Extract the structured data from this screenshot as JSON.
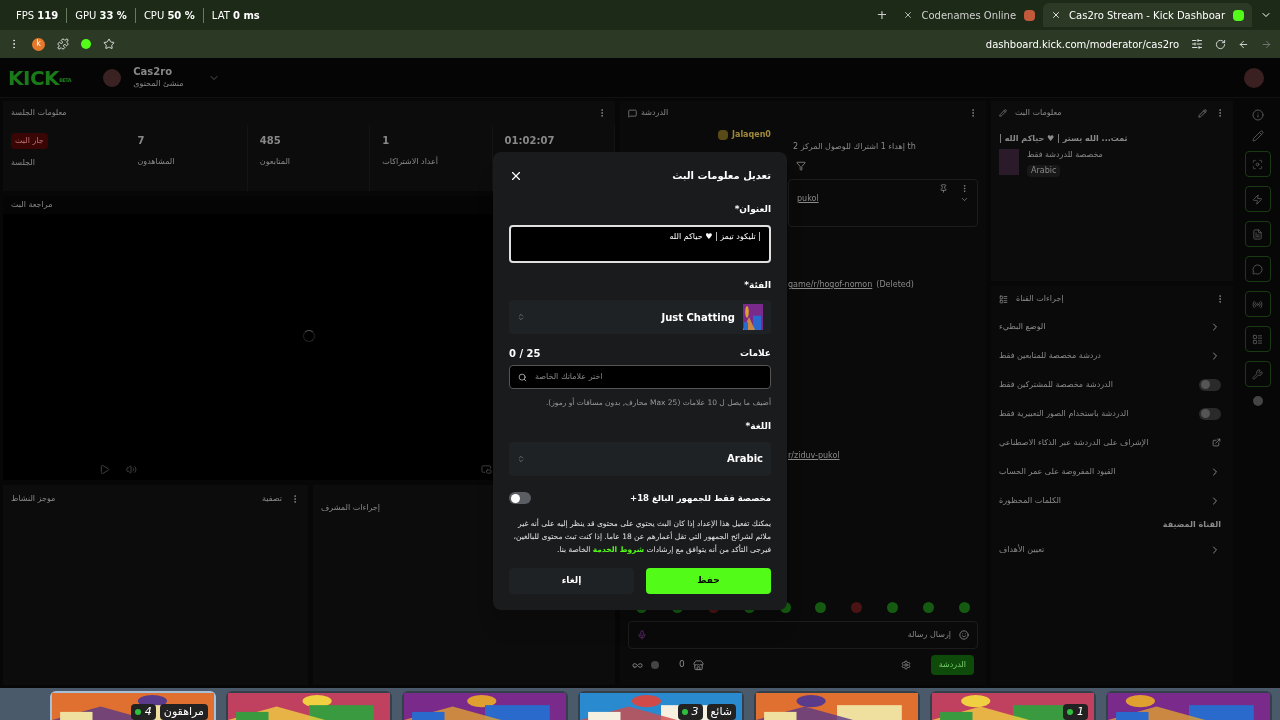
{
  "perf": [
    "LAT **0 ms**",
    "CPU **50 %**",
    "GPU **33 %**",
    "FPS **119**"
  ],
  "browser": {
    "tabs": [
      {
        "title": "Cas2ro Stream - Kick Dashboar",
        "selected": true
      },
      {
        "title": "Codenames Online",
        "selected": false
      }
    ],
    "new_tab": "+",
    "url": "dashboard.kick.com/moderator/cas2ro",
    "profile_initial": "k"
  },
  "header": {
    "logo": "KICK",
    "logo_tag": "BETA",
    "channel": "Cas2ro",
    "role": "منشئ المحتوى"
  },
  "session": {
    "title": "معلومات الجلسة",
    "stats": [
      {
        "value": "01:02:07"
      },
      {
        "value": "1",
        "label": "أعداد الاشتراكات"
      },
      {
        "value": "485",
        "label": "المتابعون"
      },
      {
        "value": "7",
        "label": "المشاهدون"
      }
    ],
    "live_badge": "جار البث",
    "live_label": "الجلسة"
  },
  "preview": {
    "title": "مراجعة البث"
  },
  "activity": {
    "title": "موجز النشاط",
    "filter": "تصفية"
  },
  "mod_actions": {
    "title": "إجراءات المشرف"
  },
  "chat": {
    "title": "الدردشة",
    "gift_user": "Jalaqen0",
    "gift_text": "إهداء 1 اشتراك للوصول المركز 2",
    "gift_suffix": "th",
    "pinned_link": "pukol",
    "messages": [
      {
        "link": "game/r/hogof-nomon",
        "note": "(Deleted)"
      },
      {
        "link": "r/ziduv-pukol"
      }
    ],
    "input_placeholder": "إرسال رسالة",
    "send": "الدردشة",
    "count": "0"
  },
  "stream_info": {
    "title": "معلومات البث",
    "stream_title": "| ثمت... الله يستر | ♥ حياكم الله",
    "category": "مخصصة للدردشة فقط",
    "language": "Arabic"
  },
  "channel_actions": {
    "title": "إجراءات القناة",
    "items": [
      {
        "kind": "chevron",
        "label": "الوضع البطيء"
      },
      {
        "kind": "chevron",
        "label": "دردشة مخصصة للمتابعين فقط"
      },
      {
        "kind": "toggle",
        "label": "الدردشة مخصصة للمشتركين فقط",
        "on": false
      },
      {
        "kind": "toggle",
        "label": "الدردشة باستخدام الصور التعبيرية فقط",
        "on": false
      },
      {
        "kind": "external",
        "label": "الإشراف على الدردشة عبر الذكاء الاصطناعي"
      },
      {
        "kind": "chevron",
        "label": "القيود المفروضة على عمر الحساب"
      },
      {
        "kind": "chevron",
        "label": "الكلمات المحظورة"
      },
      {
        "kind": "heading",
        "label": "القناة المضيفة"
      },
      {
        "kind": "chevron",
        "label": "تعيين الأهداف"
      }
    ]
  },
  "modal": {
    "title": "تعديل معلومات البث",
    "title_label": "العنوان*",
    "title_value": "| تليكود تيمز | ♥ حياكم الله",
    "category_label": "الفئة*",
    "category": "Just Chatting",
    "tags_label": "علامات",
    "tags_count": "0 / 25",
    "tags_placeholder": "اختر علاماتك الخاصة",
    "tags_hint": "أضيف ما يصل ل 10 علامات (Max 25 محارف, بدون مسافات أو رموز).",
    "language_label": "اللغة*",
    "language": "Arabic",
    "mature_label": "مخصصة فقط للجمهور البالغ 18+",
    "mature_on": false,
    "mature_text": "يمكنك تفعيل هذا الإعداد إذا كان البث يحتوي على محتوى قد ينظر إليه على أنه غير ملائم لشرائح الجمهور التي تقل أعمارهم عن 18 عاما. إذا كنت تبث محتوى للبالغين، فيرجى التأكد من أنه يتوافق مع إرشادات",
    "mature_link": "شروط الخدمة",
    "mature_tail": "الخاصة بنا.",
    "save": "حفظ",
    "cancel": "إلغاء"
  },
  "taskbar": [
    {
      "selected": false
    },
    {
      "count": "1",
      "selected": false
    },
    {
      "selected": false
    },
    {
      "badge": "شائع",
      "count": "3",
      "selected": false
    },
    {
      "selected": false
    },
    {
      "selected": false
    },
    {
      "badge": "مراهقون",
      "count": "4",
      "selected": true
    }
  ]
}
